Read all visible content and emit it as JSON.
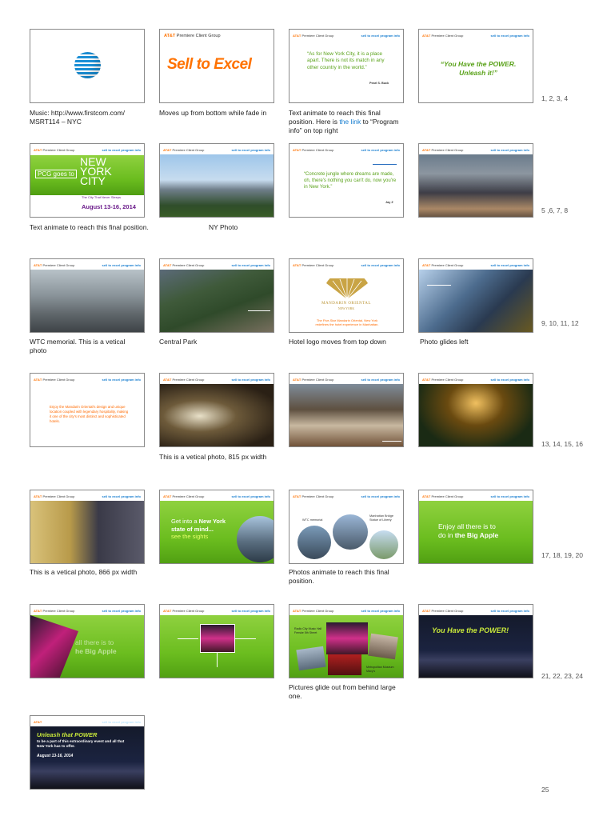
{
  "common": {
    "logo_brand": "AT&T",
    "logo_text": "Premiere Client Group",
    "link_text": "sell to excel program info"
  },
  "slides": {
    "s2_att": "AT&T",
    "s2_pcg": "Premiere Client Group",
    "s2_title": "Sell to Excel",
    "s3_quote": "“As for New York City, it is a place apart. There is not its match in any other country in the world.”",
    "s3_author": "Pearl S. Buck",
    "s4_quote": "“You Have the POWER. Unleash it!”",
    "s5_pcg": "PCG goes to",
    "s5_city1": "NEW",
    "s5_city2": "YORK",
    "s5_city3": "CITY",
    "s5_sub": "The City That Never Sleeps",
    "s5_date": "August 13-16, 2014",
    "s7_quote": "“Concrete jungle where dreams are made, oh, there's nothing you can't do, now you're in New York.”",
    "s7_author": "Jay Z",
    "s11_brand": "MANDARIN ORIENTAL",
    "s11_city": "NEW YORK",
    "s11_tag": "The Five-Star Mandarin Oriental, New York redefines the hotel experience in Manhattan.",
    "s13_text": "Enjoy the Mandarin Oriental's design and unique location coupled with legendary hospitality, making it one of the city's most distinct and sophisticated hotels.",
    "s18_line1a": "Get into a ",
    "s18_line1b": "New York",
    "s18_line2": "state of mind...",
    "s18_line3": "see the sights",
    "s19_l1": "WTC memorial",
    "s19_l2": "Manhattan Bridge Statue of Liberty",
    "s20_line1": "Enjoy all there is to",
    "s20_line2a": "do in ",
    "s20_line2b": "the Big Apple",
    "s21_line1": "all there is to",
    "s21_line2": "he Big Apple",
    "s23_l1": "Radio City Music Hall Fenske 5th Street",
    "s23_l2": "Metropolitan Museum Macy's",
    "s24_text": "You Have the POWER!",
    "s25_title": "Unleash that POWER",
    "s25_body": "to be a part of this extraordinary event and all that New York has to offer.",
    "s25_date": "August 13-16, 2014"
  },
  "captions": {
    "c1": "Music: http://www.firstcom.com/ MSRT114 – NYC",
    "c2": "Moves up from bottom while fade in",
    "c3_pre": "Text animate to reach this final position. Here is ",
    "c3_link": "the link",
    "c3_post": " to “Program info” on top right",
    "c5": "Text animate to reach this final position.",
    "c6": "NY Photo",
    "c9": "WTC memorial. This is a vetical photo",
    "c10": "Central Park",
    "c11": "Hotel logo moves from top down",
    "c12": "Photo glides left",
    "c14": "This is a vetical photo, 815 px width",
    "c17": "This is a vetical photo, 866 px width",
    "c19": "Photos animate to reach this final position.",
    "c23": "Pictures glide out from behind large one."
  },
  "row_numbers": {
    "r1": "1, 2, 3, 4",
    "r2": "5 ,6, 7, 8",
    "r3": "9, 10, 11, 12",
    "r4": "13, 14, 15, 16",
    "r5": "17, 18, 19, 20",
    "r6": "21, 22, 23, 24",
    "r7": "25"
  },
  "colors": {
    "brand_orange": "#ff7200",
    "link_blue": "#1a7fd0",
    "slide_green": "#6bbd1f",
    "date_purple": "#6a1a8a",
    "hotel_gold": "#b8902e"
  }
}
